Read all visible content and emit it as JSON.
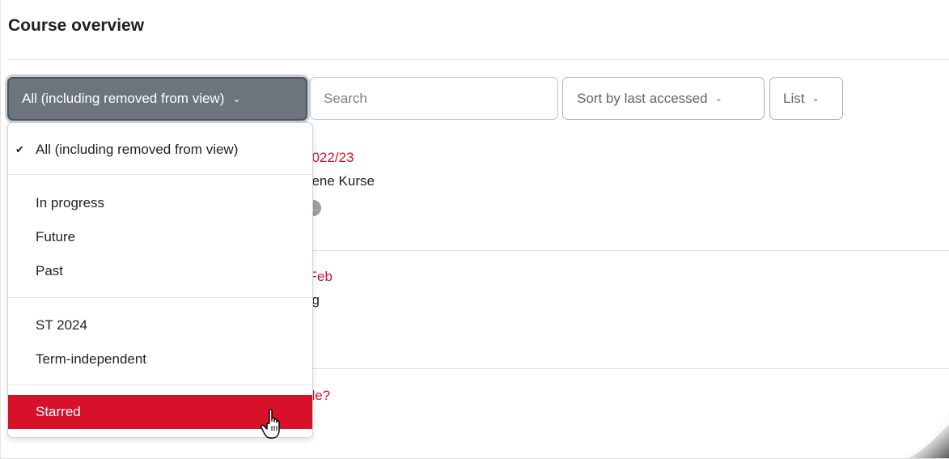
{
  "heading": "Course overview",
  "filter": {
    "label": "All (including removed from view)"
  },
  "search": {
    "placeholder": "Search"
  },
  "sort": {
    "label": "Sort by last accessed"
  },
  "view": {
    "label": "List"
  },
  "dropdown": {
    "items": [
      {
        "label": "All (including removed from view)",
        "checked": true
      },
      {
        "label": "In progress"
      },
      {
        "label": "Future"
      },
      {
        "label": "Past"
      },
      {
        "label": "ST 2024"
      },
      {
        "label": "Term-independent"
      },
      {
        "label": "Starred",
        "highlighted": true
      }
    ]
  },
  "courses": [
    {
      "name_fragment": "2022/23",
      "category_fragment": "gene Kurse"
    },
    {
      "name_fragment": "-Feb",
      "category_fragment": "ng"
    },
    {
      "name_fragment": "dle?"
    }
  ],
  "colors": {
    "accent": "#d8112b",
    "filter_bg": "#6c757d"
  }
}
